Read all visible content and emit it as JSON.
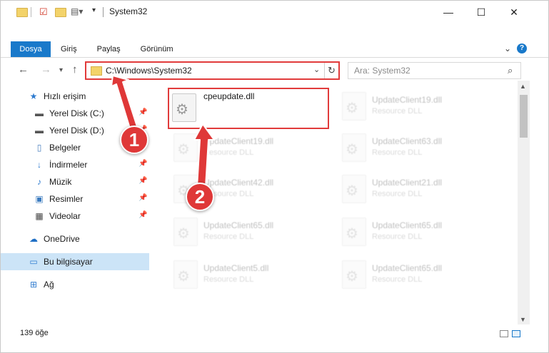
{
  "window": {
    "title": "System32",
    "controls": {
      "minimize": "—",
      "maximize": "☐",
      "close": "✕"
    }
  },
  "ribbon": {
    "tabs": [
      "Dosya",
      "Giriş",
      "Paylaş",
      "Görünüm"
    ]
  },
  "address": {
    "path": "C:\\Windows\\System32"
  },
  "search": {
    "placeholder": "Ara: System32"
  },
  "sidebar": {
    "items": [
      {
        "label": "Hızlı erişim",
        "icon": "star-icon",
        "pinned": false
      },
      {
        "label": "Yerel Disk (C:)",
        "icon": "drive-icon",
        "pinned": true
      },
      {
        "label": "Yerel Disk (D:)",
        "icon": "drive-icon",
        "pinned": true
      },
      {
        "label": "Belgeler",
        "icon": "document-icon",
        "pinned": true
      },
      {
        "label": "İndirmeler",
        "icon": "download-icon",
        "pinned": true
      },
      {
        "label": "Müzik",
        "icon": "music-icon",
        "pinned": true
      },
      {
        "label": "Resimler",
        "icon": "pictures-icon",
        "pinned": true
      },
      {
        "label": "Videolar",
        "icon": "video-icon",
        "pinned": true
      },
      {
        "label": "OneDrive",
        "icon": "cloud-icon",
        "pinned": false
      },
      {
        "label": "Bu bilgisayar",
        "icon": "computer-icon",
        "pinned": false,
        "selected": true
      },
      {
        "label": "Ağ",
        "icon": "network-icon",
        "pinned": false
      }
    ]
  },
  "files": [
    {
      "name": "cpeupdate.dll",
      "type": "",
      "highlighted": true
    },
    {
      "name": "UpdateClient19.dll",
      "type": "Resource DLL"
    },
    {
      "name": "UpdateClient19.dll",
      "type": "Resource DLL"
    },
    {
      "name": "UpdateClient63.dll",
      "type": "Resource DLL"
    },
    {
      "name": "UpdateClient42.dll",
      "type": "Resource DLL"
    },
    {
      "name": "UpdateClient21.dll",
      "type": "Resource DLL"
    },
    {
      "name": "UpdateClient65.dll",
      "type": "Resource DLL"
    },
    {
      "name": "UpdateClient65.dll",
      "type": "Resource DLL"
    },
    {
      "name": "UpdateClient5.dll",
      "type": "Resource DLL"
    },
    {
      "name": "UpdateClient65.dll",
      "type": "Resource DLL"
    }
  ],
  "status": {
    "count": "139 öğe"
  },
  "annotations": {
    "step1": "1",
    "step2": "2",
    "color": "#df3838"
  }
}
